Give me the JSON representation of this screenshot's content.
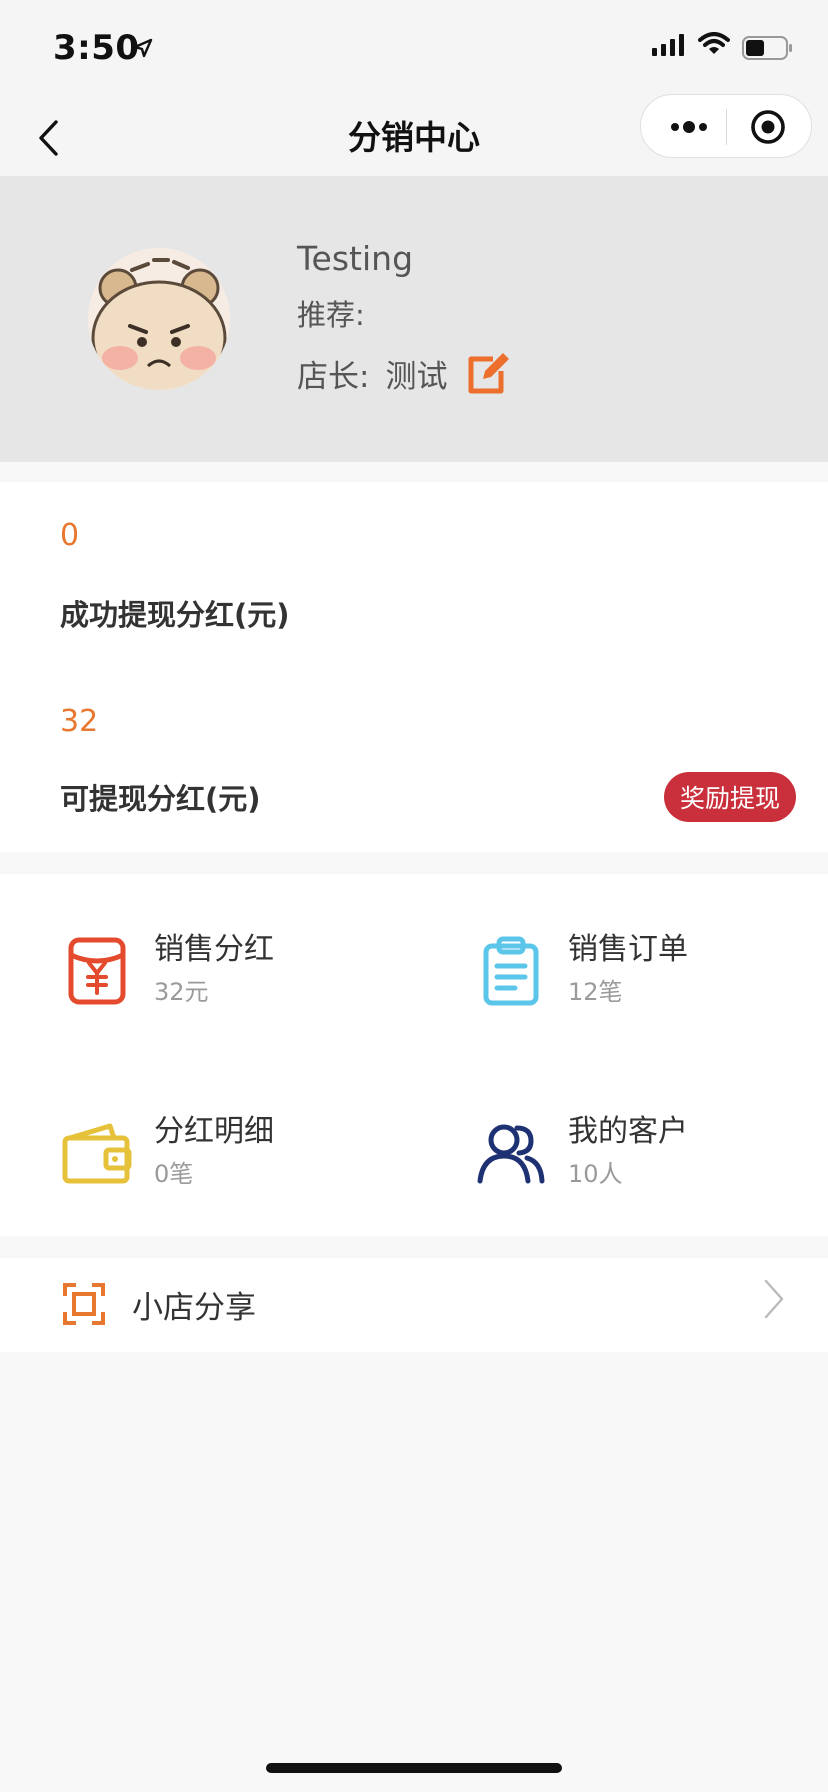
{
  "status_bar": {
    "time": "3:50"
  },
  "nav": {
    "title": "分销中心"
  },
  "profile": {
    "name": "Testing",
    "referrer_label": "推荐:",
    "owner_label": "店长:",
    "owner_value": "测试"
  },
  "stats": {
    "withdrawn_value": "0",
    "withdrawn_label": "成功提现分红(元)",
    "available_value": "32",
    "available_label": "可提现分红(元)",
    "withdraw_button": "奖励提现"
  },
  "grid": [
    {
      "title": "销售分红",
      "sub": "32元",
      "icon": "red-envelope-icon"
    },
    {
      "title": "销售订单",
      "sub": "12笔",
      "icon": "clipboard-icon"
    },
    {
      "title": "分红明细",
      "sub": "0笔",
      "icon": "wallet-icon"
    },
    {
      "title": "我的客户",
      "sub": "10人",
      "icon": "users-icon"
    }
  ],
  "share": {
    "label": "小店分享"
  },
  "colors": {
    "accent_orange": "#e8782f",
    "withdraw_red": "#c9303b",
    "icon_red": "#e44a2e",
    "icon_cyan": "#5bc6ea",
    "icon_yellow": "#e5c23a",
    "icon_navy": "#1e3173"
  }
}
